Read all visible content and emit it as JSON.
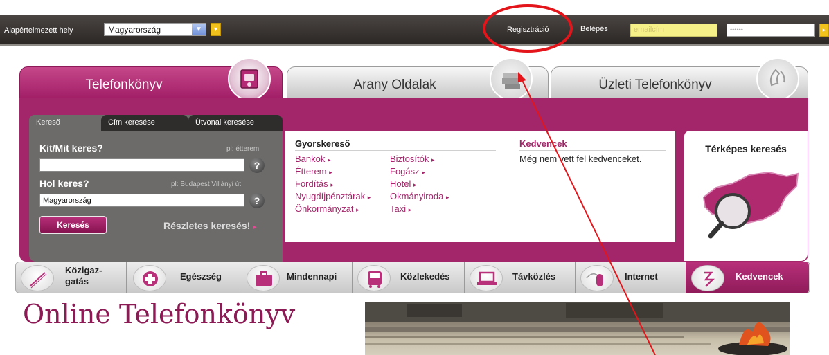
{
  "topbar": {
    "location_label": "Alapértelmezett hely",
    "location_value": "Magyarország",
    "register_link": "Regisztráció",
    "login_label": "Belépés",
    "email_placeholder": "emailcím",
    "password_mask": "••••••"
  },
  "tabs": [
    {
      "label": "Telefonkönyv",
      "active": true,
      "icon": "phonebook-icon"
    },
    {
      "label": "Arany Oldalak",
      "active": false,
      "icon": "books-icon"
    },
    {
      "label": "Üzleti Telefonkönyv",
      "active": false,
      "icon": "phone-handset-icon"
    }
  ],
  "search": {
    "tabs": [
      "Kereső",
      "Cím keresése",
      "Útvonal keresése"
    ],
    "who_label": "Kit/Mit keres?",
    "who_hint": "pl: étterem",
    "who_value": "",
    "where_label": "Hol keres?",
    "where_hint": "pl: Budapest Villányi út",
    "where_value": "Magyarország",
    "help_glyph": "?",
    "search_button": "Keresés",
    "advanced_link": "Részletes keresés!",
    "arrow_glyph": "▸"
  },
  "quick": {
    "heading": "Gyorskereső",
    "col1": [
      "Bankok",
      "Étterem",
      "Fordítás",
      "Nyugdíjpénztárak",
      "Önkormányzat"
    ],
    "col2": [
      "Biztosítók",
      "Fogász",
      "Hotel",
      "Okmányiroda",
      "Taxi"
    ]
  },
  "favorites": {
    "heading": "Kedvencek",
    "empty_text": "Még nem vett fel kedvenceket."
  },
  "map_search": {
    "title": "Térképes keresés"
  },
  "categories": [
    {
      "line1": "Közigaz-",
      "line2": "gatás",
      "icon": "pen-icon"
    },
    {
      "label": "Egészség",
      "icon": "medical-cross-icon"
    },
    {
      "label": "Mindennapi",
      "icon": "briefcase-icon"
    },
    {
      "label": "Közlekedés",
      "icon": "bus-icon"
    },
    {
      "label": "Távközlés",
      "icon": "laptop-icon"
    },
    {
      "label": "Internet",
      "icon": "mouse-icon"
    },
    {
      "label": "Kedvencek",
      "icon": "favorites-icon",
      "active": true
    }
  ],
  "page_title": "Online Telefonkönyv",
  "colors": {
    "brand": "#a3266a",
    "annotation": "#e4141b",
    "topbar": "#3a3633"
  }
}
